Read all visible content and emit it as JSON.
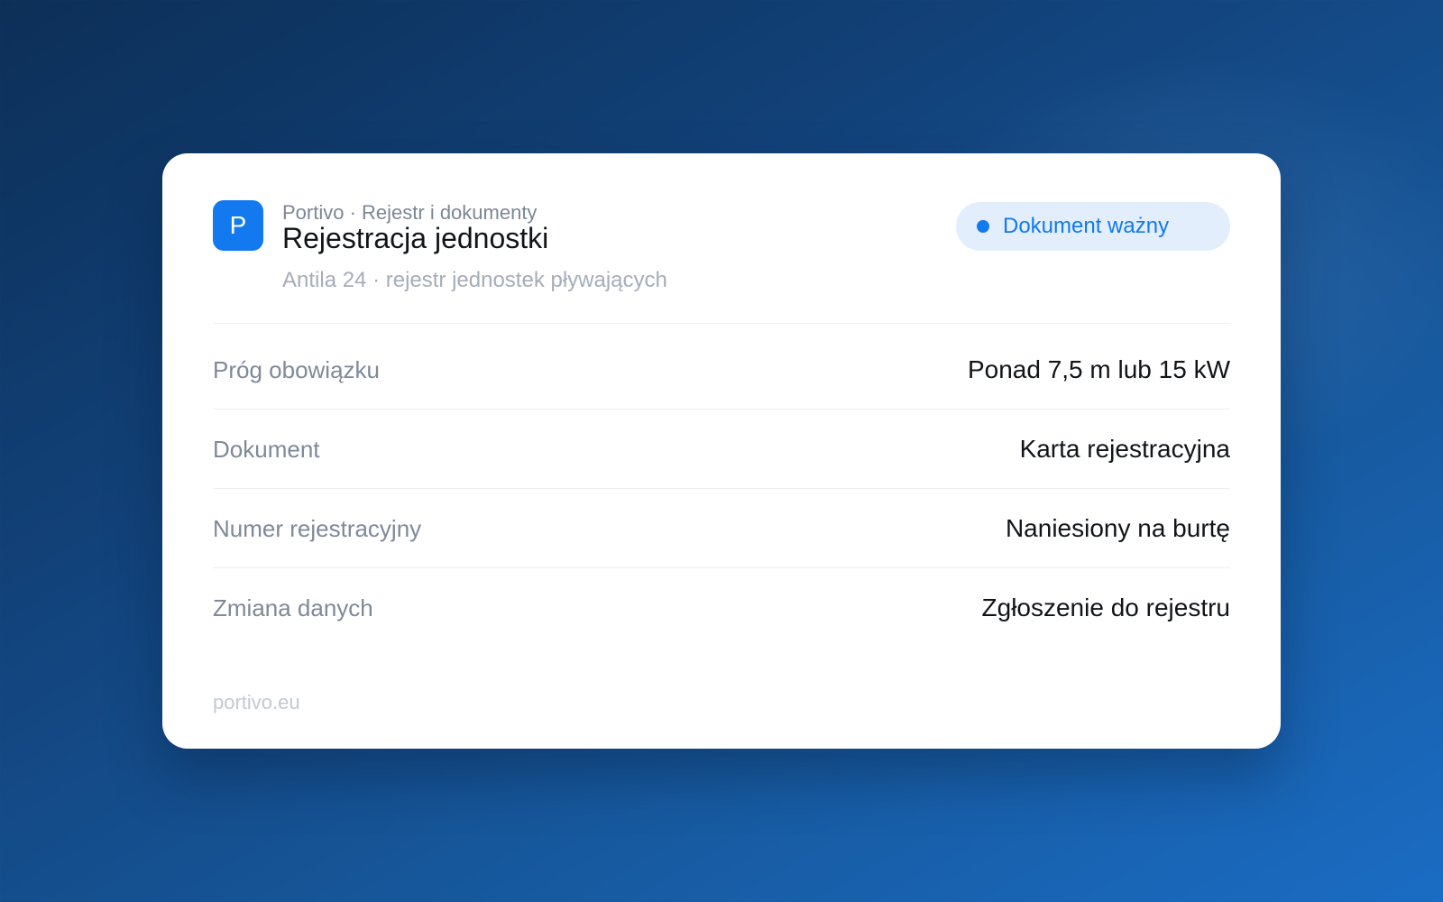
{
  "colors": {
    "accent": "#1279ee",
    "badge_bg": "#e3eefc",
    "background_start": "#0c2f57",
    "background_end": "#1a6cc4"
  },
  "header": {
    "app_icon_letter": "P",
    "breadcrumb": "Portivo · Rejestr i dokumenty",
    "title": "Rejestracja jednostki",
    "subtitle": "Antila 24 · rejestr jednostek pływających"
  },
  "status": {
    "icon": "status-dot-icon",
    "label": "Dokument ważny"
  },
  "rows": [
    {
      "label": "Próg obowiązku",
      "value": "Ponad 7,5 m lub 15 kW"
    },
    {
      "label": "Dokument",
      "value": "Karta rejestracyjna"
    },
    {
      "label": "Numer rejestracyjny",
      "value": "Naniesiony na burtę"
    },
    {
      "label": "Zmiana danych",
      "value": "Zgłoszenie do rejestru"
    }
  ],
  "footer": {
    "domain": "portivo.eu"
  }
}
